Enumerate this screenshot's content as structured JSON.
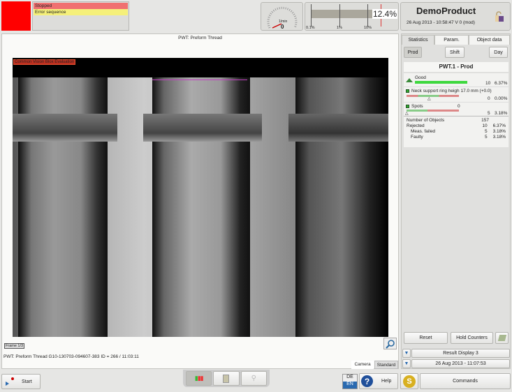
{
  "status": {
    "color": "#ff0000",
    "lines": [
      {
        "text": "Stopped",
        "color": "#f07070"
      },
      {
        "text": "Error sequence",
        "color": "#f5f07a"
      }
    ]
  },
  "gauge": {
    "unit": "1/min",
    "value": "0"
  },
  "reject_bar": {
    "value": "12.4%",
    "fraction": 0.124,
    "ticks": [
      "0.1%",
      "1%",
      "10%"
    ]
  },
  "product": {
    "name": "DemoProduct",
    "info": "26 Aug 2013 - 10:58:47  V 0 (mod)",
    "lock_icon": "unlocked-padlock-icon"
  },
  "camera": {
    "title": "PWT: Preform Thread",
    "overlay": "Common Vision Blox Evaluation",
    "frame": "Frame 1/3",
    "caption": "PWT: Preform Thread G10-130703-094607-383  ID = 266 / 11:03:11",
    "tabs": [
      "Camera",
      "Standard"
    ],
    "active_tab": "Camera"
  },
  "right": {
    "tabs": [
      "Statistics",
      "Param.",
      "Object data"
    ],
    "period_buttons": [
      "Prod",
      "Shift",
      "Day"
    ],
    "title": "PWT.1 - Prod",
    "good": {
      "label": "Good",
      "count": "10",
      "pct": "6.37%"
    },
    "neck": {
      "label": "Neck support ring heigh 17.0 mm (+0.0)",
      "count": "0",
      "pct": "0.00%"
    },
    "spots": {
      "label": "Spots",
      "value": "0",
      "count": "5",
      "pct": "3.18%"
    },
    "summary": [
      {
        "label": "Number of Objects",
        "count": "157",
        "pct": ""
      },
      {
        "label": "Rejected",
        "count": "10",
        "pct": "6.37%"
      },
      {
        "label": "Meas. failed",
        "count": "5",
        "pct": "3.18%"
      },
      {
        "label": "Faulty",
        "count": "5",
        "pct": "3.18%"
      }
    ],
    "reset": "Reset",
    "hold": "Hold Counters",
    "result_display": "Result Display 3",
    "result_date": "26 Aug 2013 - 11:07:53"
  },
  "bottom": {
    "start": "Start",
    "lang_top": "DE",
    "lang_bottom": "EN",
    "help": "Help",
    "commands": "Commands"
  }
}
